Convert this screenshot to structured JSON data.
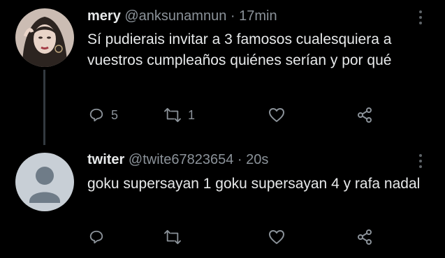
{
  "tweets": [
    {
      "name": "mery",
      "handle": "@anksunamnun",
      "separator": "·",
      "time": "17min",
      "text": "Sí pudierais invitar a 3 famosos cualesquiera a vuestros cumpleaños quiénes serían y por qué",
      "reply_count": "5",
      "retweet_count": "1",
      "like_count": "",
      "avatar": "profile-photo"
    },
    {
      "name": "twiter",
      "handle": "@twite67823654",
      "separator": "·",
      "time": "20s",
      "text": "goku supersayan 1 goku supersayan 4 y rafa nadal",
      "reply_count": "",
      "retweet_count": "",
      "like_count": "",
      "avatar": "default-avatar"
    }
  ],
  "icons": {
    "reply": "reply-icon",
    "retweet": "retweet-icon",
    "like": "heart-icon",
    "share": "share-icon",
    "more": "more-vertical-icon"
  },
  "colors": {
    "background": "#000000",
    "text": "#e7e9ea",
    "muted": "#8b9299",
    "thread_line": "#333a40",
    "default_avatar_bg": "#c8cfd6",
    "default_avatar_fg": "#6f7c88"
  }
}
